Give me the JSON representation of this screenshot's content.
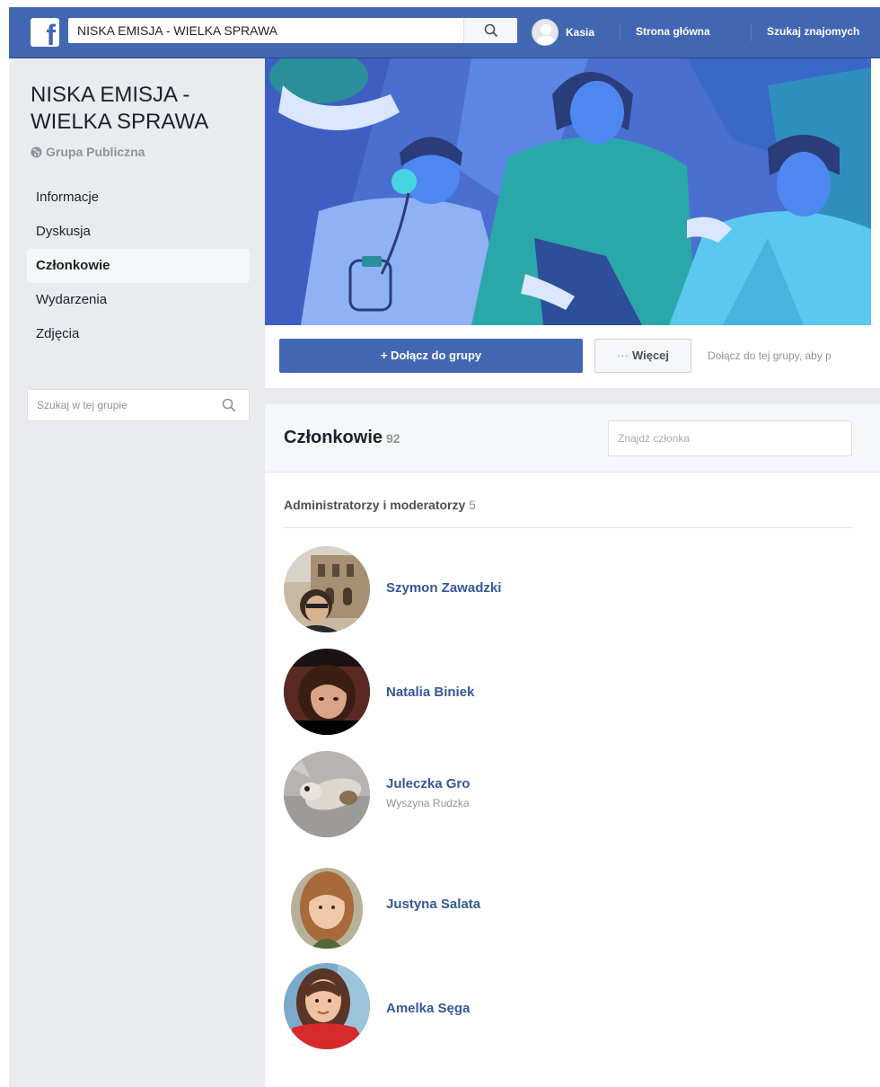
{
  "header": {
    "search_value": "NISKA EMISJA - WIELKA SPRAWA",
    "user_name": "Kasia",
    "nav_links": [
      "Strona główna",
      "Szukaj znajomych"
    ]
  },
  "sidebar": {
    "group_name": "NISKA EMISJA - WIELKA SPRAWA",
    "group_type": "Grupa Publiczna",
    "items": [
      {
        "label": "Informacje",
        "active": false
      },
      {
        "label": "Dyskusja",
        "active": false
      },
      {
        "label": "Członkowie",
        "active": true
      },
      {
        "label": "Wydarzenia",
        "active": false
      },
      {
        "label": "Zdjęcia",
        "active": false
      }
    ],
    "search_placeholder": "Szukaj w tej grupie"
  },
  "actions": {
    "join_label": "+ Dołącz do grupy",
    "more_label": "Więcej",
    "join_hint": "Dołącz do tej grupy, aby p"
  },
  "members": {
    "title": "Członkowie",
    "count": "92",
    "find_placeholder": "Znajdź członka",
    "section_title": "Administratorzy i moderatorzy",
    "section_count": "5",
    "list": [
      {
        "name": "Szymon Zawadzki",
        "subtitle": ""
      },
      {
        "name": "Natalia Biniek",
        "subtitle": ""
      },
      {
        "name": "Juleczka Gro",
        "subtitle": "Wyszyna Rudzka"
      },
      {
        "name": "Justyna Salata",
        "subtitle": ""
      },
      {
        "name": "Amelka Sęga",
        "subtitle": ""
      }
    ]
  },
  "colors": {
    "brand_blue": "#4267b2",
    "link_blue": "#365899",
    "sidebar_bg": "#e9ebee",
    "muted_text": "#90949c"
  }
}
